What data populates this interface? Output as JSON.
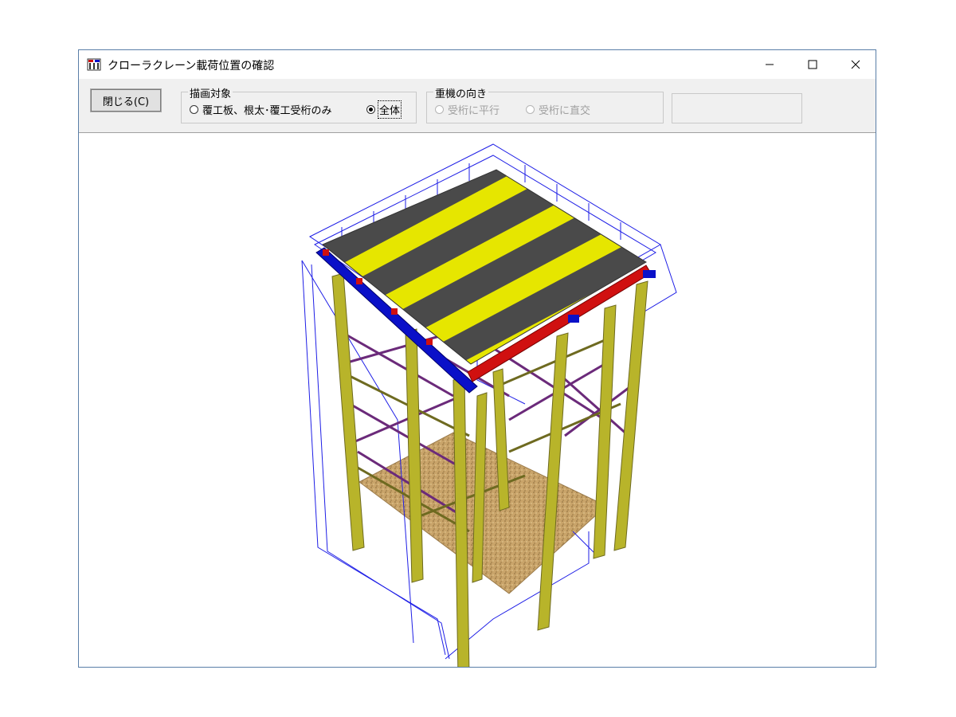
{
  "window": {
    "title": "クローラクレーン載荷位置の確認",
    "controls": {
      "minimize": "minimize",
      "maximize": "maximize",
      "close": "close"
    }
  },
  "toolbar": {
    "close_label": "閉じる(C)",
    "draw_target": {
      "legend": "描画対象",
      "options": [
        {
          "label": "覆工板、根太･覆工受桁のみ",
          "selected": false
        },
        {
          "label": "全体",
          "selected": true
        }
      ]
    },
    "crane_direction": {
      "legend": "重機の向き",
      "disabled": true,
      "options": [
        {
          "label": "受桁に平行",
          "selected": false
        },
        {
          "label": "受桁に直交",
          "selected": false
        }
      ]
    }
  },
  "colors": {
    "deck_dark": "#4a4a4a",
    "deck_stripe": "#e6e600",
    "girder_blue": "#0a10c8",
    "girder_red": "#d01010",
    "pile_yellow": "#b8b42a",
    "brace_purple": "#6b2a7a",
    "ground": "#c9a46a",
    "wireframe": "#1e1ee6"
  }
}
